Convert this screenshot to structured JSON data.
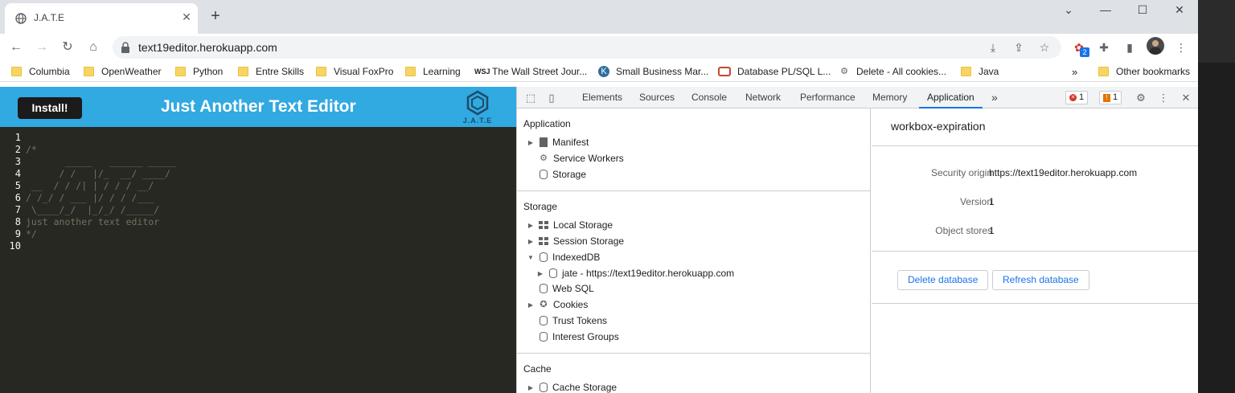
{
  "browser": {
    "tab_title": "J.A.T.E",
    "url": "text19editor.herokuapp.com",
    "extension_badge": "2"
  },
  "bookmarks": [
    {
      "label": "Columbia",
      "icon": "folder-icon"
    },
    {
      "label": "OpenWeather",
      "icon": "folder-icon"
    },
    {
      "label": "Python",
      "icon": "folder-icon"
    },
    {
      "label": "Entre Skills",
      "icon": "folder-icon"
    },
    {
      "label": "Visual FoxPro",
      "icon": "folder-icon"
    },
    {
      "label": "Learning",
      "icon": "folder-icon"
    },
    {
      "label": "The Wall Street Jour...",
      "icon": "wsj-icon"
    },
    {
      "label": "Small Business Mar...",
      "icon": "k-icon"
    },
    {
      "label": "Database PL/SQL L...",
      "icon": "oracle-icon"
    },
    {
      "label": "Delete - All cookies...",
      "icon": "gear-icon"
    },
    {
      "label": "Java",
      "icon": "folder-icon"
    }
  ],
  "other_bookmarks": "Other bookmarks",
  "app": {
    "install_label": "Install!",
    "title": "Just Another Text Editor",
    "logo_text": "J.A.T.E",
    "line_numbers": [
      "1",
      "2",
      "3",
      "4",
      "5",
      "6",
      "7",
      "8",
      "9",
      "10"
    ],
    "code_lines": [
      "",
      "/*",
      "       _____   ______ _____",
      "      / /   |/_  __/ ____/",
      " __  / / /| | / / / __/",
      "/ /_/ / ___ |/ / / /___",
      " \\____/_/  |_/_/ /_____/",
      "just another text editor",
      "*/",
      ""
    ]
  },
  "devtools": {
    "tabs": [
      "Elements",
      "Sources",
      "Console",
      "Network",
      "Performance",
      "Memory",
      "Application"
    ],
    "active_tab": "Application",
    "more_tabs": "»",
    "error_count": "1",
    "warning_count": "1",
    "sections": {
      "application": {
        "title": "Application",
        "items": [
          "Manifest",
          "Service Workers",
          "Storage"
        ]
      },
      "storage": {
        "title": "Storage",
        "items": [
          "Local Storage",
          "Session Storage",
          "IndexedDB",
          "jate - https://text19editor.herokuapp.com",
          "Web SQL",
          "Cookies",
          "Trust Tokens",
          "Interest Groups"
        ]
      },
      "cache": {
        "title": "Cache",
        "items": [
          "Cache Storage"
        ]
      }
    },
    "detail": {
      "db_name": "workbox-expiration",
      "security_origin_label": "Security origin",
      "security_origin_value": "https://text19editor.herokuapp.com",
      "version_label": "Version",
      "version_value": "1",
      "object_stores_label": "Object stores",
      "object_stores_value": "1",
      "delete_button": "Delete database",
      "refresh_button": "Refresh database"
    }
  }
}
